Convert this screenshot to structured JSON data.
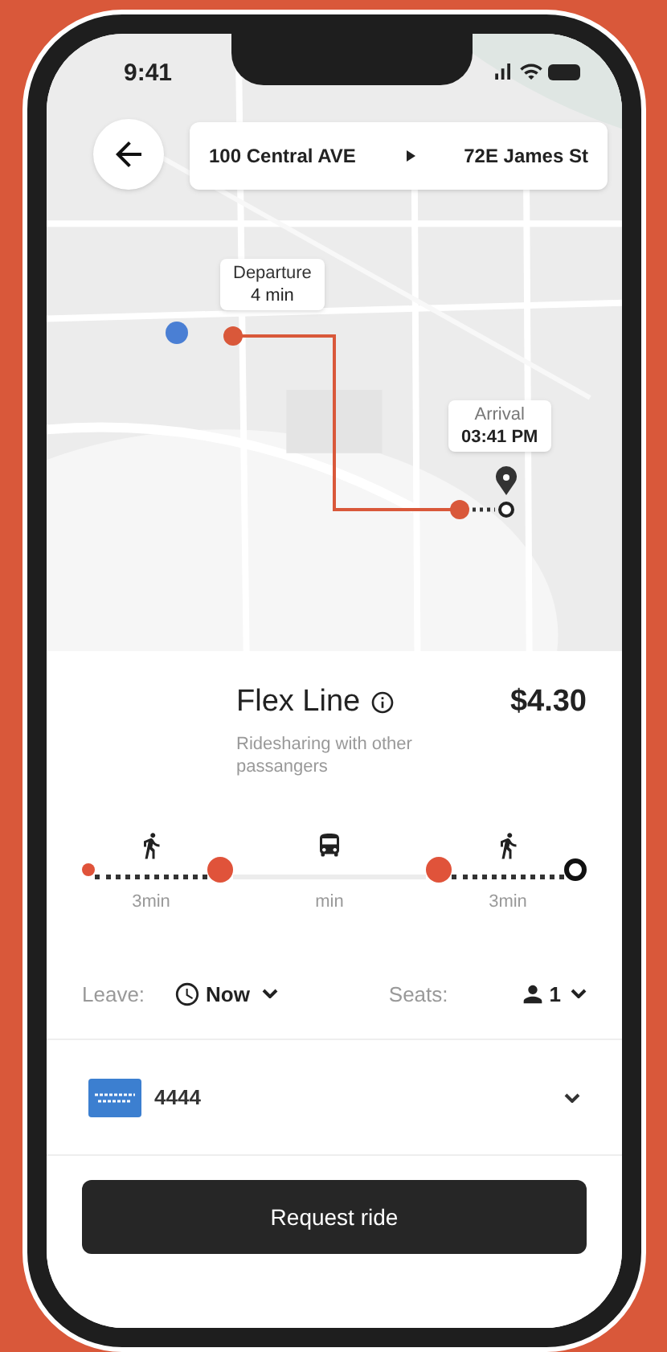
{
  "status_bar": {
    "time": "9:41"
  },
  "route": {
    "from": "100 Central AVE",
    "to": "72E James St"
  },
  "departure": {
    "label": "Departure",
    "time": "4 min"
  },
  "arrival": {
    "label": "Arrival",
    "time": "03:41 PM"
  },
  "ride": {
    "name": "Flex Line",
    "price": "$4.30",
    "description": "Ridesharing with other passangers"
  },
  "legs": [
    {
      "kind": "walk",
      "duration": "3min"
    },
    {
      "kind": "bus",
      "duration": "min"
    },
    {
      "kind": "walk",
      "duration": "3min"
    }
  ],
  "options": {
    "leave_label": "Leave:",
    "leave_value": "Now",
    "seats_label": "Seats:",
    "seats_value": "1"
  },
  "payment": {
    "card_number": "4444"
  },
  "action": "Request ride"
}
